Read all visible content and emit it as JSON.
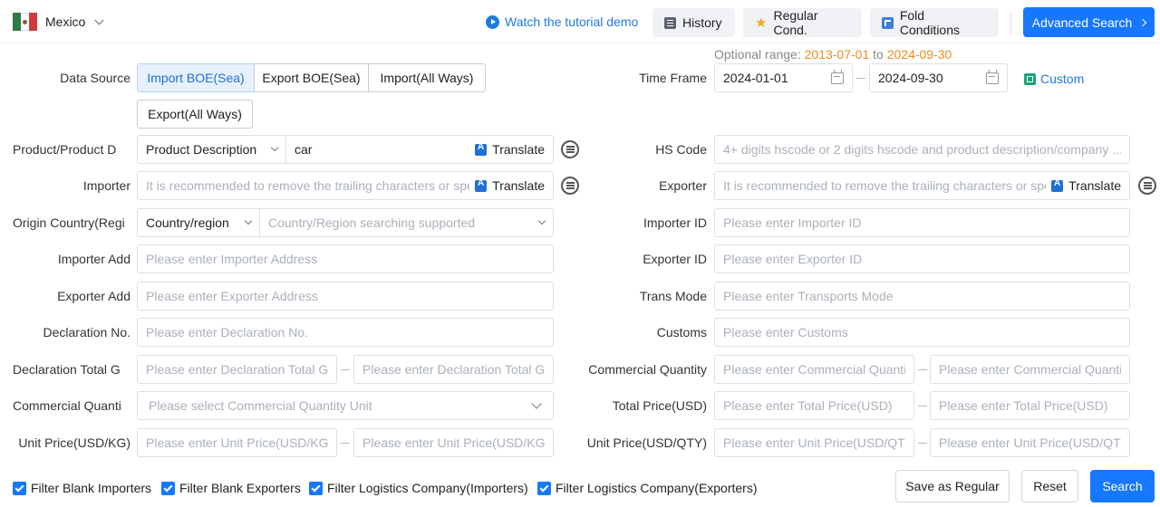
{
  "header": {
    "country": "Mexico",
    "tutorial": "Watch the tutorial demo",
    "history": "History",
    "regular": "Regular Cond.",
    "fold": "Fold Conditions",
    "advanced": "Advanced Search"
  },
  "data_source": {
    "label": "Data Source",
    "options": [
      "Import BOE(Sea)",
      "Export BOE(Sea)",
      "Import(All Ways)",
      "Export(All Ways)"
    ],
    "selected": "Import BOE(Sea)"
  },
  "time_frame": {
    "label": "Time Frame",
    "hint_prefix": "Optional range:",
    "range_start": "2013-07-01",
    "hint_to": "to",
    "range_end": "2024-09-30",
    "start": "2024-01-01",
    "end": "2024-09-30",
    "custom": "Custom"
  },
  "product": {
    "label": "Product/Product D",
    "type": "Product Description",
    "value": "car",
    "translate": "Translate"
  },
  "hs_code": {
    "label": "HS Code",
    "placeholder": "4+ digits hscode or 2 digits hscode and product description/company ..."
  },
  "importer": {
    "label": "Importer",
    "placeholder": "It is recommended to remove the trailing characters or spe",
    "translate": "Translate"
  },
  "exporter": {
    "label": "Exporter",
    "placeholder": "It is recommended to remove the trailing characters or spe",
    "translate": "Translate"
  },
  "origin": {
    "label": "Origin Country(Regi",
    "type": "Country/region",
    "placeholder": "Country/Region searching supported"
  },
  "importer_id": {
    "label": "Importer ID",
    "placeholder": "Please enter Importer ID"
  },
  "importer_add": {
    "label": "Importer Add",
    "placeholder": "Please enter Importer Address"
  },
  "exporter_id": {
    "label": "Exporter ID",
    "placeholder": "Please enter Exporter ID"
  },
  "exporter_add": {
    "label": "Exporter Add",
    "placeholder": "Please enter Exporter Address"
  },
  "trans_mode": {
    "label": "Trans Mode",
    "placeholder": "Please enter Transports Mode"
  },
  "declaration_no": {
    "label": "Declaration No.",
    "placeholder": "Please enter Declaration No."
  },
  "customs": {
    "label": "Customs",
    "placeholder": "Please enter Customs"
  },
  "decl_total": {
    "label": "Declaration Total G",
    "placeholder_from": "Please enter Declaration Total Gr",
    "placeholder_to": "Please enter Declaration Total Gr"
  },
  "comm_qty": {
    "label": "Commercial Quantity",
    "placeholder_from": "Please enter Commercial Quantity",
    "placeholder_to": "Please enter Commercial Quantity"
  },
  "comm_qty_unit": {
    "label": "Commercial Quanti",
    "placeholder": "Please select Commercial Quantity Unit"
  },
  "total_price": {
    "label": "Total Price(USD)",
    "placeholder_from": "Please enter Total Price(USD)",
    "placeholder_to": "Please enter Total Price(USD)"
  },
  "unit_price_kg": {
    "label": "Unit Price(USD/KG)",
    "placeholder_from": "Please enter Unit Price(USD/KG)",
    "placeholder_to": "Please enter Unit Price(USD/KG)"
  },
  "unit_price_qty": {
    "label": "Unit Price(USD/QTY)",
    "placeholder_from": "Please enter Unit Price(USD/QTY)",
    "placeholder_to": "Please enter Unit Price(USD/QTY)"
  },
  "filters": {
    "blank_importers": "Filter Blank Importers",
    "blank_exporters": "Filter Blank Exporters",
    "logistics_importers": "Filter Logistics Company(Importers)",
    "logistics_exporters": "Filter Logistics Company(Exporters)"
  },
  "actions": {
    "save": "Save as Regular",
    "reset": "Reset",
    "search": "Search"
  },
  "colors": {
    "primary": "#1677ff",
    "link": "#1f7ae0",
    "orange": "#f08a1d",
    "segment_active_bg": "#e6f1fd"
  }
}
